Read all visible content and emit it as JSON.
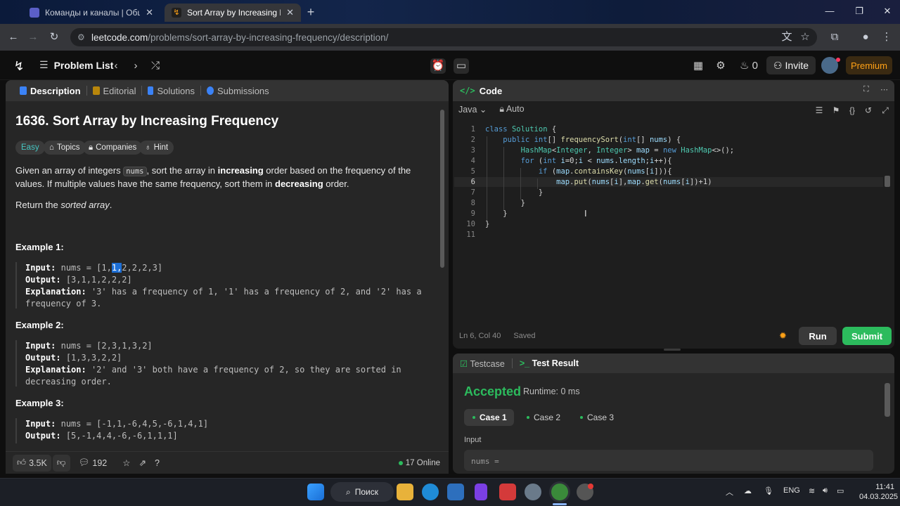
{
  "browser": {
    "tabs": [
      {
        "label": "Команды и каналы | Общий | "
      },
      {
        "label": "Sort Array by Increasing Freque"
      }
    ],
    "url_domain": "leetcode.com",
    "url_path": "/problems/sort-array-by-increasing-frequency/description/"
  },
  "header": {
    "problem_list": "Problem List",
    "streak": "0",
    "invite": "Invite",
    "premium": "Premium"
  },
  "left_tabs": [
    "Description",
    "Editorial",
    "Solutions",
    "Submissions"
  ],
  "problem": {
    "title": "1636. Sort Array by Increasing Frequency",
    "difficulty": "Easy",
    "chips": [
      "Topics",
      "Companies",
      "Hint"
    ],
    "para1_a": "Given an array of integers ",
    "para1_code": "nums",
    "para1_b": ", sort the array in ",
    "para1_bold1": "increasing",
    "para1_c": " order based on the frequency of the values. If multiple values have the same frequency, sort them in ",
    "para1_bold2": "decreasing",
    "para1_d": " order.",
    "para2_a": "Return the ",
    "para2_em": "sorted array",
    "para2_b": "."
  },
  "examples": [
    {
      "heading": "Example 1:",
      "input_label": "Input:",
      "input_pre": "nums = [1,",
      "input_hl": "1,",
      "input_post": "2,2,2,3]",
      "output_label": "Output:",
      "output": "[3,1,1,2,2,2]",
      "expl_label": "Explanation:",
      "expl": "'3' has a frequency of 1, '1' has a frequency of 2, and '2' has a frequency of 3."
    },
    {
      "heading": "Example 2:",
      "input_label": "Input:",
      "input": "nums = [2,3,1,3,2]",
      "output_label": "Output:",
      "output": "[1,3,3,2,2]",
      "expl_label": "Explanation:",
      "expl": "'2' and '3' both have a frequency of 2, so they are sorted in decreasing order."
    },
    {
      "heading": "Example 3:",
      "input_label": "Input:",
      "input": "nums = [-1,1,-6,4,5,-6,1,4,1]",
      "output_label": "Output:",
      "output": "[5,-1,4,4,-6,-6,1,1,1]"
    }
  ],
  "footer": {
    "likes": "3.5K",
    "comments": "192",
    "online": "17 Online"
  },
  "code_panel": {
    "title": "Code",
    "language": "Java",
    "mode": "Auto",
    "lines": [
      "1",
      "2",
      "3",
      "4",
      "5",
      "6",
      "7",
      "8",
      "9",
      "10",
      "11"
    ],
    "status_pos": "Ln 6, Col 40",
    "status_saved": "Saved",
    "run": "Run",
    "submit": "Submit"
  },
  "result_panel": {
    "tab_testcase": "Testcase",
    "tab_result": "Test Result",
    "verdict": "Accepted",
    "runtime": "Runtime: 0 ms",
    "cases": [
      "Case 1",
      "Case 2",
      "Case 3"
    ],
    "input_label": "Input",
    "input_value": "nums ="
  },
  "taskbar": {
    "search": "Поиск",
    "lang": "ENG",
    "time": "11:41",
    "date": "04.03.2025"
  },
  "colors": {
    "accent_green": "#2cbb5d",
    "easy": "#46c6c2",
    "premium": "#ffa116",
    "selection": "#1d6fd6"
  }
}
